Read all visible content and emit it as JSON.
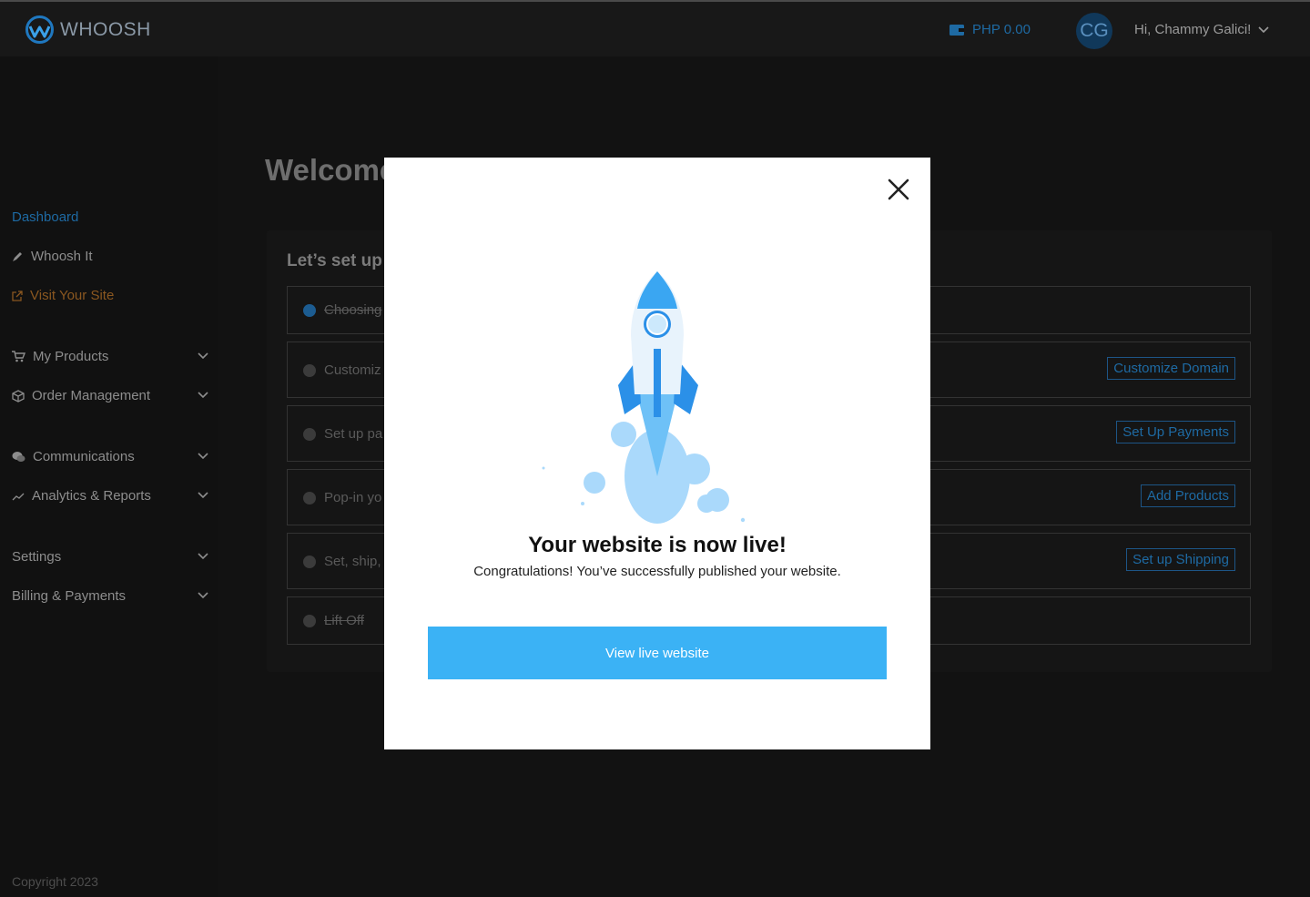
{
  "header": {
    "brand": "WHOOSH",
    "wallet": "PHP 0.00",
    "avatar_initials": "CG",
    "greeting": "Hi, Chammy Galici!"
  },
  "sidebar": {
    "items": [
      {
        "label": "Dashboard"
      },
      {
        "label": "Whoosh It"
      },
      {
        "label": "Visit Your Site"
      },
      {
        "label": "My Products"
      },
      {
        "label": "Order Management"
      },
      {
        "label": "Communications"
      },
      {
        "label": "Analytics & Reports"
      },
      {
        "label": "Settings"
      },
      {
        "label": "Billing & Payments"
      }
    ],
    "copyright": "Copyright 2023"
  },
  "main": {
    "welcome": "Welcome",
    "setup_title": "Let’s set up y",
    "steps": [
      {
        "label": "Choosing",
        "done": true,
        "button": ""
      },
      {
        "label": "Customiz",
        "done": false,
        "button": "Customize Domain"
      },
      {
        "label": "Set up pa",
        "done": false,
        "button": "Set Up Payments"
      },
      {
        "label": "Pop-in yo",
        "done": false,
        "button": "Add Products"
      },
      {
        "label": "Set, ship,",
        "done": false,
        "button": "Set up Shipping"
      },
      {
        "label": "Lift Off",
        "done": true,
        "button": ""
      }
    ]
  },
  "modal": {
    "title": "Your website is now live!",
    "subtitle": "Congratulations! You’ve successfully published your website.",
    "cta": "View live website"
  },
  "colors": {
    "accent": "#3bb2f5",
    "link": "#1e6aa3",
    "visit": "#8a5720"
  }
}
